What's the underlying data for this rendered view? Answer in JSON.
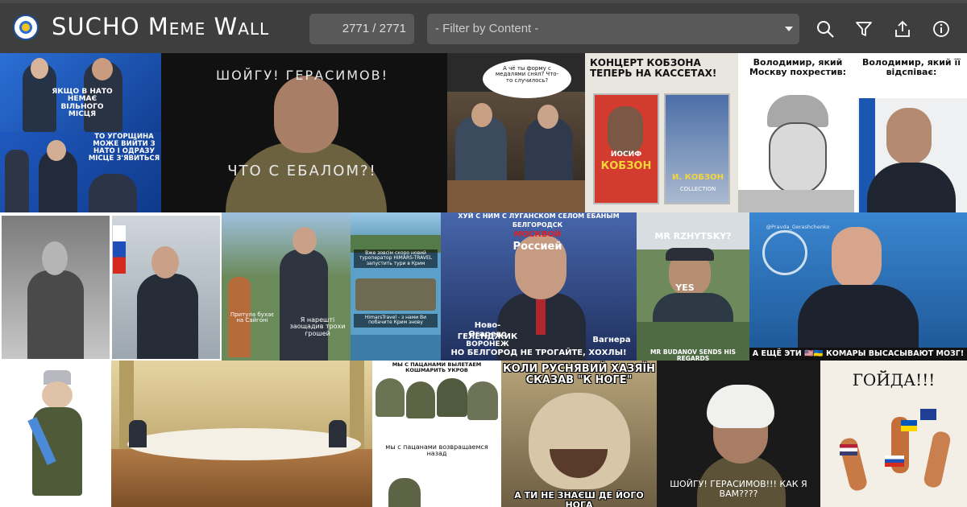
{
  "app": {
    "title_main": "SUCHO",
    "title_sub": "Meme Wall"
  },
  "toolbar": {
    "counter": "2771 / 2771",
    "filter_placeholder": "- Filter by Content -",
    "icons": [
      "search-icon",
      "filter-icon",
      "share-icon",
      "info-icon"
    ]
  },
  "memes": {
    "m1": {
      "top": "ЯКЩО В НАТО НЕМАЄ ВІЛЬНОГО МІСЦЯ",
      "bottom": "ТО УГОРЩИНА МОЖЕ ВИЙТИ З НАТО І ОДРАЗУ МІСЦЕ З'ЯВИТЬСЯ"
    },
    "m2": {
      "top": "ШОЙГУ! ГЕРАСИМОВ!",
      "bottom": "ЧТО С ЕБАЛОМ?!"
    },
    "m3": {
      "bubble": "А чё ты форму с медалями снял? Что-то случилось?"
    },
    "m4": {
      "top": "КОНЦЕРТ КОБЗОНА ТЕПЕРЬ НА КАССЕТАХ!",
      "tape1a": "ИОСИФ",
      "tape1b": "КОБЗОН",
      "tape2": "И. КОБЗОН",
      "tape2b": "COLLECTION"
    },
    "m5": {
      "left": "Володимир, який Москву похрестив:",
      "right": "Володимир, який її відспіває:"
    },
    "m7": {
      "left": "Притула бухає на Сайгоні",
      "right": "Я нарешті заощадив трохи грошей"
    },
    "m8": {
      "top": "Вже зовсім скоро новий туроператор HIMARS-TRAVEL запустить тури в Крим",
      "bottom": "HimarsTravel - з нами Ви побачите Крим знову"
    },
    "m9": {
      "top": "ХУЙ С НИМ С ЛУГАНСКОМ СЕЛОМ ЕБАНЫМ",
      "l2": "БЕЛГОРОДСК",
      "l3": "МОСКВОЙ",
      "l4": "Россией",
      "left": "Ново-Огарево",
      "left2": "ГЕЛЕНДЖИК",
      "left3": "ВОРОНЕЖ",
      "right": "Вагнера",
      "bottom": "НО БЕЛГОРОД НЕ ТРОГАЙТЕ, ХОХЛЫ!"
    },
    "m10": {
      "top": "MR RZHYTSKY?",
      "mid": "YES",
      "bottom": "MR BUDANOV SENDS HIS REGARDS"
    },
    "m11": {
      "watermark": "@Pravda_Gerashchenko",
      "bottom": "А ЕЩЁ ЭТИ 🇺🇸🇺🇦 КОМАРЫ ВЫСАСЫВАЮТ МОЗГ!"
    },
    "m14": {
      "top": "МЫ С ПАЦАНАМИ ВЫЛЕТАЕМ КОШМАРИТЬ УКРОВ",
      "bottom": "мы с пацанами возвращаемся назад"
    },
    "m15": {
      "top": "КОЛИ РУСНЯВИЙ ХАЗЯЇН СКАЗАВ \"К НОГЕ\"",
      "bottom": "А ТИ НЕ ЗНАЄШ ДЕ ЙОГО НОГА"
    },
    "m16": {
      "bottom": "ШОЙГУ! ГЕРАСИМОВ!!! КАК Я ВАМ????"
    },
    "m17": {
      "top": "ГОЙДА!!!"
    }
  },
  "colors": {
    "topbar": "#3e3e3e",
    "input": "#595959",
    "grid_bg": "#2c2c2c"
  }
}
